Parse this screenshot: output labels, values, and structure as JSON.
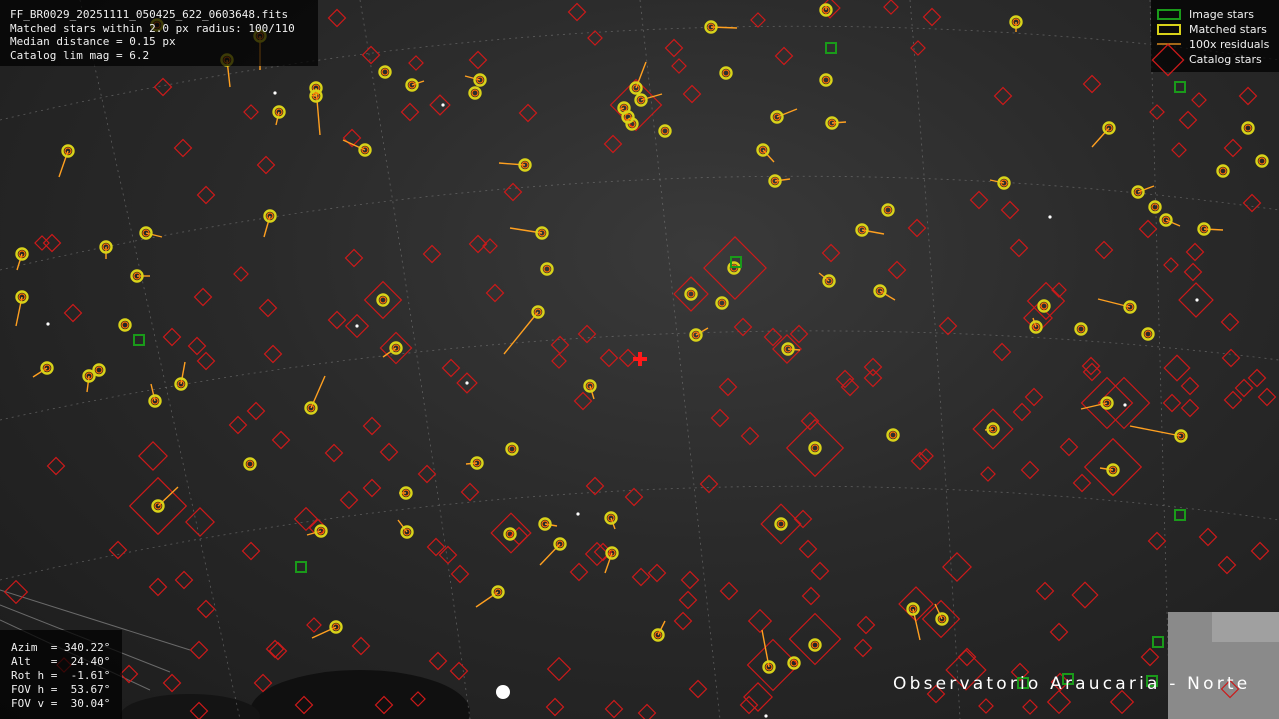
{
  "info": {
    "filename": "FF_BR0029_20251111_050425_622_0603648.fits",
    "matched": "Matched stars within 2.0 px radius: 100/110",
    "median": "Median distance = 0.15 px",
    "limmag": "Catalog lim mag = 6.2"
  },
  "pointing": {
    "azim": "Azim  = 340.22°",
    "alt": "Alt   =  24.40°",
    "roth": "Rot h =  -1.61°",
    "fovh": "FOV h =  53.67°",
    "fovv": "FOV v =  30.04°"
  },
  "legend": {
    "image_stars": "Image stars",
    "matched_stars": "Matched stars",
    "residuals": "100x residuals",
    "catalog_stars": "Catalog stars"
  },
  "station_label": "Observatorio Araucaria - Norte",
  "colors": {
    "image_star": "#1a9a1a",
    "matched_ring": "#d9d219",
    "matched_inner": "#ff6f00",
    "residual": "#ffa020",
    "catalog": "#cc1a1a",
    "center_marker": "#ff1a1a"
  }
}
